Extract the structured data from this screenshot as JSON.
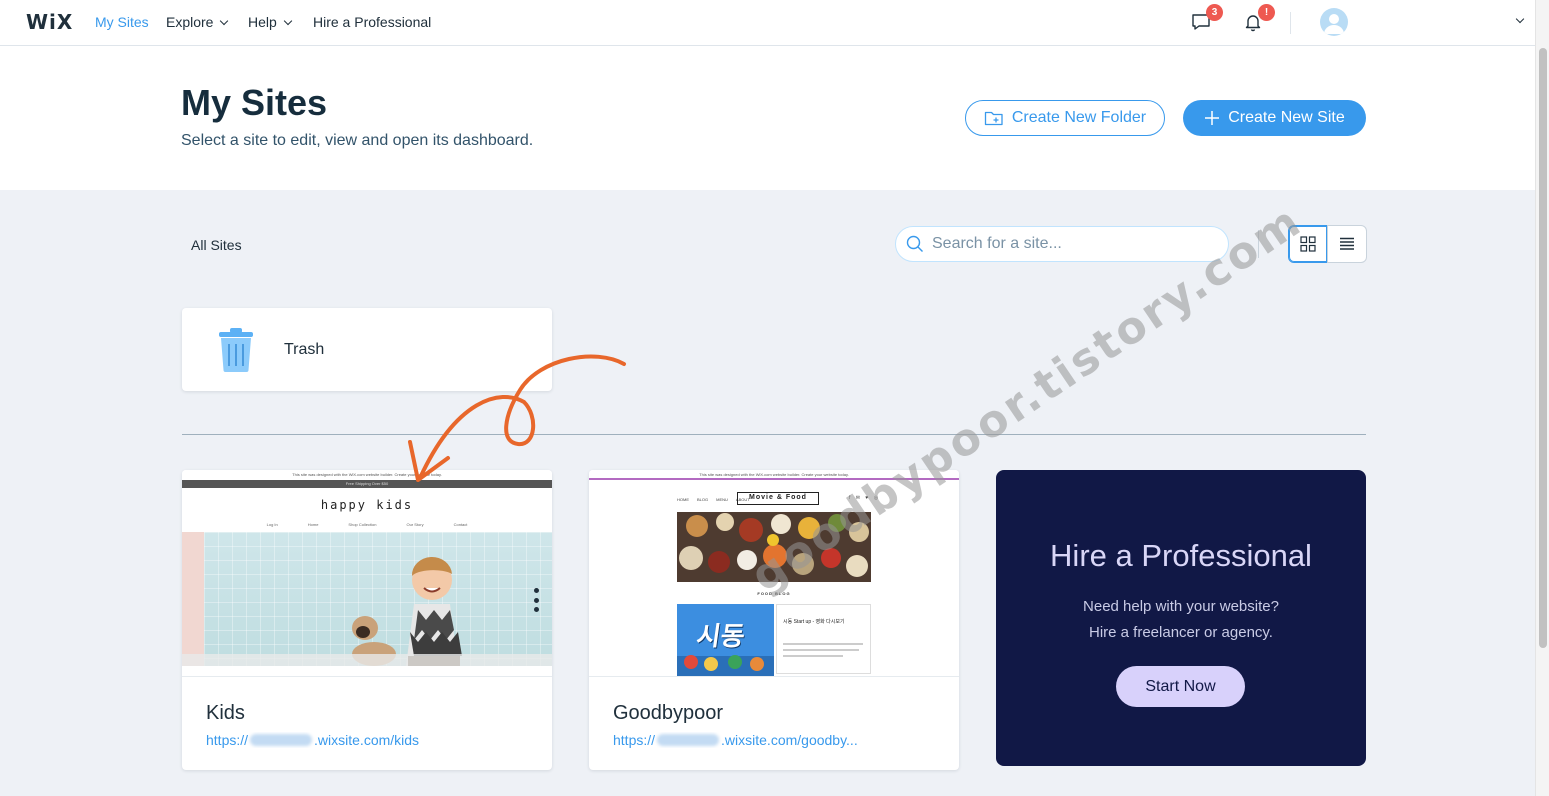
{
  "nav": {
    "logo": "WiX",
    "links": [
      "My Sites",
      "Explore",
      "Help",
      "Hire a Professional"
    ],
    "messages_badge": "3",
    "notifications_badge": "!"
  },
  "header": {
    "title": "My Sites",
    "subtitle": "Select a site to edit, view and open its dashboard.",
    "create_folder": "Create New Folder",
    "create_site": "Create New Site"
  },
  "toolbar": {
    "all_sites": "All Sites",
    "search_placeholder": "Search for a site..."
  },
  "trash": {
    "label": "Trash"
  },
  "sites": [
    {
      "name": "Kids",
      "url_prefix": "https://",
      "url_suffix": ".wixsite.com/kids",
      "thumb": {
        "top_banner": "This site was designed with the WiX.com website builder. Create your website today.",
        "band": "Free Shipping Over $50",
        "brand": "happy kids",
        "nav": [
          "Log In",
          "Home",
          "Shop Collection",
          "Our Story",
          "Contact"
        ]
      }
    },
    {
      "name": "Goodbypoor",
      "url_prefix": "https://",
      "url_suffix": ".wixsite.com/goodby...",
      "thumb": {
        "top_banner": "This site was designed with the WiX.com website builder. Create your website today.",
        "nav": [
          "HOME",
          "BLOG",
          "MENU",
          "ABOUT"
        ],
        "logo": "Movie & Food",
        "social": "f ✉ ♥ ◎",
        "section": "FOOD BLOG",
        "poster": "시동",
        "post_title": "시동 Start up - 영화 다시보기"
      }
    }
  ],
  "hire": {
    "title": "Hire a Professional",
    "line1": "Need help with your website?",
    "line2": "Hire a freelancer or agency.",
    "button": "Start Now"
  },
  "watermark": "goodbypoor.tistory.com",
  "colors": {
    "accent": "#3899ec",
    "hire_bg": "#111846",
    "hire_btn": "#d8d1fb",
    "badge": "#ee5951",
    "arrow": "#e8672b"
  }
}
